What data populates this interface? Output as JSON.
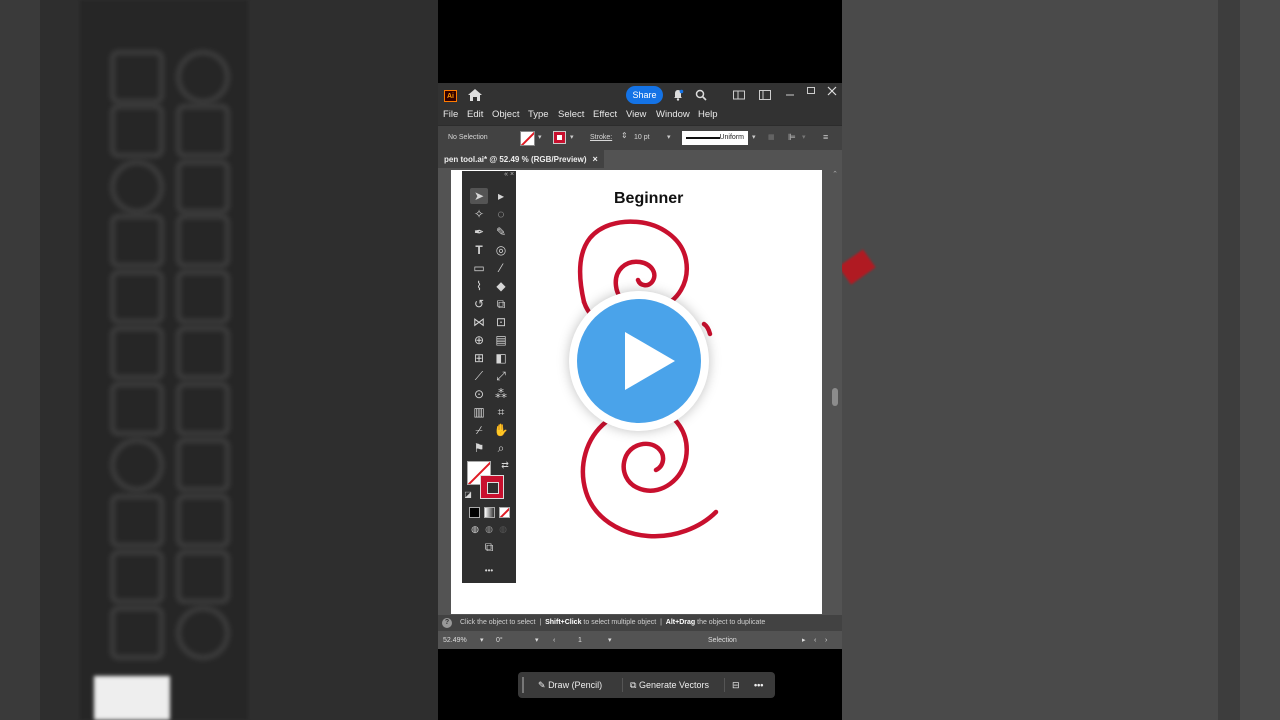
{
  "window": {
    "app_logo": "Ai",
    "share_label": "Share",
    "icons": [
      "home-icon",
      "bell-icon",
      "search-icon",
      "arrange-icon",
      "panel-icon",
      "minimize-icon",
      "maximize-icon",
      "close-icon"
    ]
  },
  "menu": [
    "File",
    "Edit",
    "Object",
    "Type",
    "Select",
    "Effect",
    "View",
    "Window",
    "Help"
  ],
  "control_bar": {
    "selection": "No Selection",
    "stroke_label": "Stroke:",
    "stroke_weight": "10 pt",
    "stroke_profile": "Uniform"
  },
  "document_tab": {
    "title": "pen tool.ai* @ 52.49 % (RGB/Preview)",
    "close": "×"
  },
  "artboard": {
    "title": "Beginner",
    "stroke_color": "#c8102e"
  },
  "context_bar": {
    "draw_label": "Draw (Pencil)",
    "generate_label": "Generate Vectors",
    "more": "•••"
  },
  "status": {
    "part1": "Click the object to select",
    "part2_key": "Shift+Click",
    "part2": "to select multiple object",
    "part3_key": "Alt+Drag",
    "part3": "the object to duplicate"
  },
  "bottom": {
    "zoom": "52.49%",
    "rotation": "0°",
    "artboard_num": "1",
    "tool": "Selection"
  },
  "toolbar_more": "•••"
}
